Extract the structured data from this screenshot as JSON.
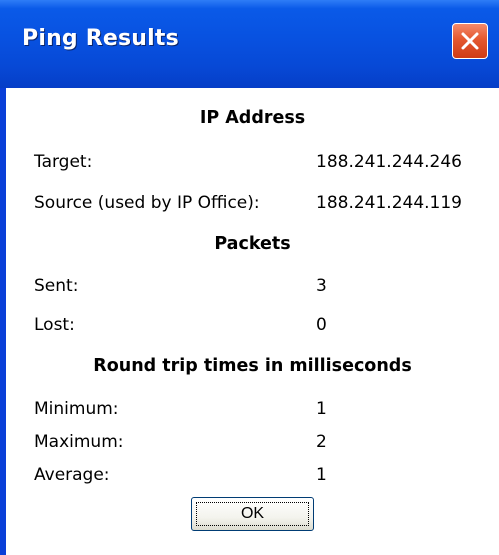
{
  "window": {
    "title": "Ping Results"
  },
  "ip_address": {
    "heading": "IP Address",
    "target_label": "Target:",
    "target_value": "188.241.244.246",
    "source_label": "Source (used by IP Office):",
    "source_value": "188.241.244.119"
  },
  "packets": {
    "heading": "Packets",
    "sent_label": "Sent:",
    "sent_value": "3",
    "lost_label": "Lost:",
    "lost_value": "0"
  },
  "round_trip": {
    "heading": "Round trip times in milliseconds",
    "minimum_label": "Minimum:",
    "minimum_value": "1",
    "maximum_label": "Maximum:",
    "maximum_value": "2",
    "average_label": "Average:",
    "average_value": "1"
  },
  "buttons": {
    "ok_label": "OK"
  },
  "icons": {
    "close": "close-icon"
  },
  "colors": {
    "titlebar": "#0a5ae8",
    "close_button": "#e4582f",
    "client_background": "#ffffff"
  }
}
